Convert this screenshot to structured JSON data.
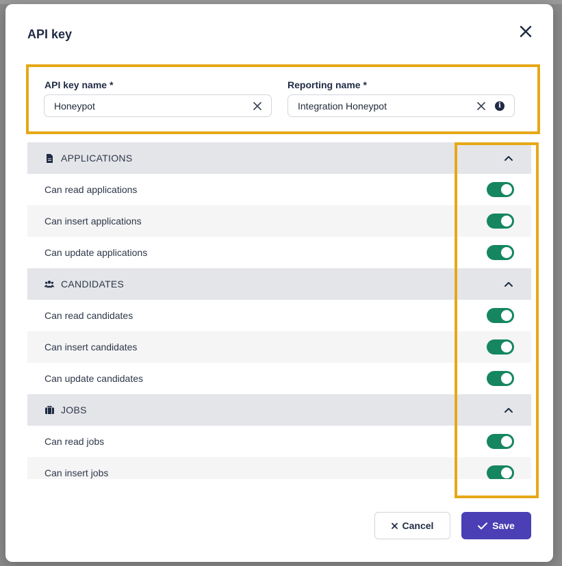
{
  "modal": {
    "title": "API key"
  },
  "fields": {
    "api_key_name": {
      "label": "API key name",
      "required_mark": "*",
      "value": "Honeypot"
    },
    "reporting_name": {
      "label": "Reporting name",
      "required_mark": "*",
      "value": "Integration Honeypot"
    }
  },
  "sections": [
    {
      "title": "APPLICATIONS",
      "icon": "document-icon",
      "expanded": true,
      "permissions": [
        {
          "label": "Can read applications",
          "enabled": true
        },
        {
          "label": "Can insert applications",
          "enabled": true
        },
        {
          "label": "Can update applications",
          "enabled": true
        }
      ]
    },
    {
      "title": "CANDIDATES",
      "icon": "users-icon",
      "expanded": true,
      "permissions": [
        {
          "label": "Can read candidates",
          "enabled": true
        },
        {
          "label": "Can insert candidates",
          "enabled": true
        },
        {
          "label": "Can update candidates",
          "enabled": true
        }
      ]
    },
    {
      "title": "JOBS",
      "icon": "briefcase-icon",
      "expanded": true,
      "permissions": [
        {
          "label": "Can read jobs",
          "enabled": true
        },
        {
          "label": "Can insert jobs",
          "enabled": true
        }
      ]
    }
  ],
  "footer": {
    "cancel_label": "Cancel",
    "save_label": "Save"
  },
  "colors": {
    "toggle_on": "#15865f",
    "primary": "#4a3fb5",
    "highlight": "#e6a817"
  }
}
